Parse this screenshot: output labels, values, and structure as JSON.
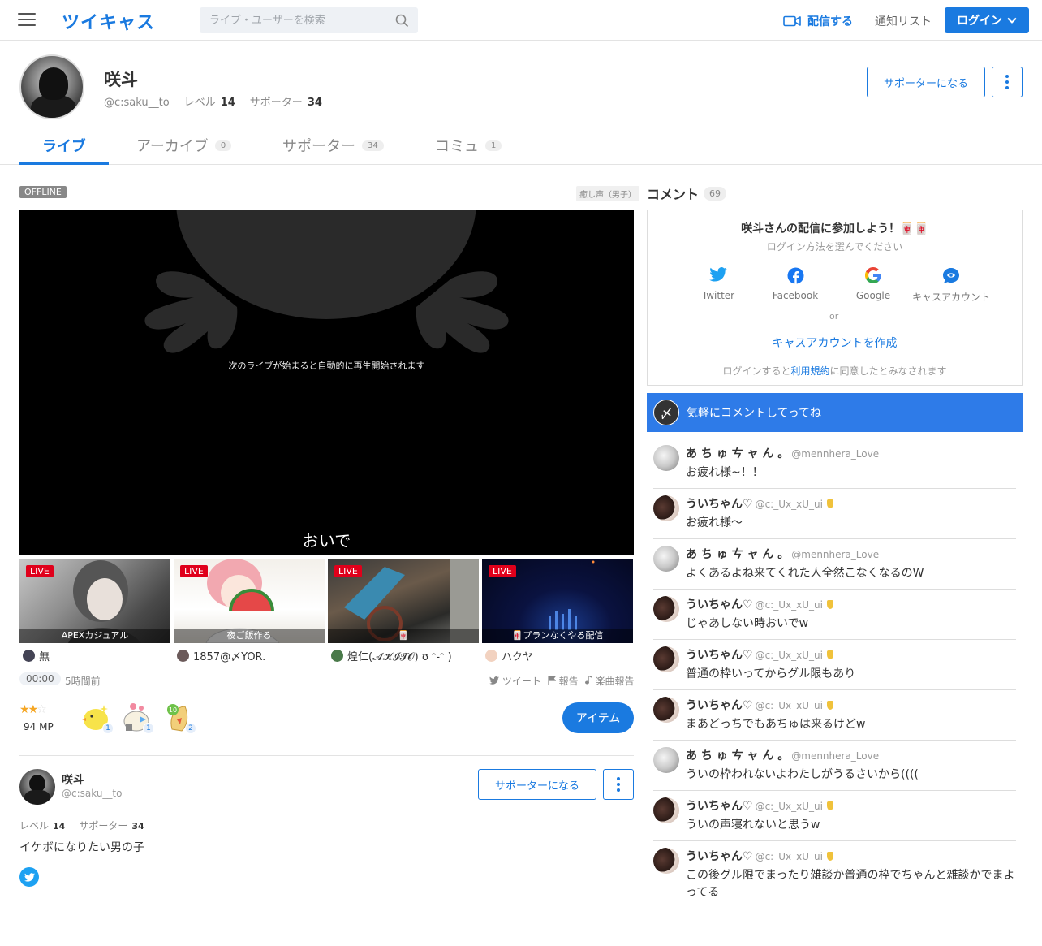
{
  "header": {
    "logo": "ツイキャス",
    "search_placeholder": "ライブ・ユーザーを検索",
    "broadcast_label": "配信する",
    "notification_label": "通知リスト",
    "login_label": "ログイン"
  },
  "profile": {
    "name": "咲斗",
    "id": "@c:saku__to",
    "level_label": "レベル",
    "level": "14",
    "supporter_label": "サポーター",
    "supporter_count": "34",
    "become_supporter": "サポーターになる"
  },
  "tabs": [
    {
      "label": "ライブ",
      "count": ""
    },
    {
      "label": "アーカイブ",
      "count": "0"
    },
    {
      "label": "サポーター",
      "count": "34"
    },
    {
      "label": "コミュ",
      "count": "1"
    }
  ],
  "live": {
    "status": "OFFLINE",
    "tag": "癒し声（男子）",
    "player_message": "次のライブが始まると自動的に再生開始されます",
    "player_title": "おいで",
    "time": "00:00",
    "ago": "5時間前",
    "tweet": "ツイート",
    "report": "報告",
    "music_report": "楽曲報告",
    "mp": "94 MP",
    "item_button": "アイテム",
    "gifts": [
      {
        "count": "1"
      },
      {
        "count": "1"
      },
      {
        "count": "2"
      }
    ]
  },
  "thumbs": [
    {
      "live": "LIVE",
      "caption": "APEXカジュアル",
      "user": "無"
    },
    {
      "live": "LIVE",
      "caption": "夜ご飯作る",
      "user": "1857@〆YOR."
    },
    {
      "live": "LIVE",
      "caption": "🀄",
      "user": "煌仁(𝓐𝓚𝓘𝓣𝓞) ʊ ᵔ-ᵔ )"
    },
    {
      "live": "LIVE",
      "caption": "🀄プランなくやる配信",
      "user": "ハクヤ"
    }
  ],
  "about": {
    "name": "咲斗",
    "id": "@c:saku__to",
    "level_label": "レベル",
    "level": "14",
    "supporter_label": "サポーター",
    "supporter_count": "34",
    "bio": "イケボになりたい男の子",
    "become_supporter": "サポーターになる"
  },
  "comments_panel": {
    "title": "コメント",
    "count": "69",
    "login_title": "咲斗さんの配信に参加しよう！🀄🀄",
    "login_sub": "ログイン方法を選んでください",
    "options": [
      "Twitter",
      "Facebook",
      "Google",
      "キャスアカウント"
    ],
    "or": "or",
    "create_account": "キャスアカウントを作成",
    "terms_pre": "ログインすると",
    "terms_link": "利用規約",
    "terms_post": "に同意したとみなされます",
    "input_placeholder": "気軽にコメントしてってね"
  },
  "comments": [
    {
      "name": "あ ち ゅ ㄘ ャ ん 。",
      "id": "@mennhera_Love",
      "text": "お疲れ様~！！",
      "medal": false,
      "av": "a"
    },
    {
      "name": "ういちゃん♡",
      "id": "@c:_Ux_xU_ui",
      "text": "お疲れ様〜",
      "medal": true,
      "av": "b"
    },
    {
      "name": "あ ち ゅ ㄘ ャ ん 。",
      "id": "@mennhera_Love",
      "text": "よくあるよね来てくれた人全然こなくなるのW",
      "medal": false,
      "av": "a"
    },
    {
      "name": "ういちゃん♡",
      "id": "@c:_Ux_xU_ui",
      "text": "じゃあしない時おいでw",
      "medal": true,
      "av": "b"
    },
    {
      "name": "ういちゃん♡",
      "id": "@c:_Ux_xU_ui",
      "text": "普通の枠いってからグル限もあり",
      "medal": true,
      "av": "b"
    },
    {
      "name": "ういちゃん♡",
      "id": "@c:_Ux_xU_ui",
      "text": "まあどっちでもあちゅは来るけどw",
      "medal": true,
      "av": "b"
    },
    {
      "name": "あ ち ゅ ㄘ ャ ん 。",
      "id": "@mennhera_Love",
      "text": "ういの枠われないよわたしがうるさいから((((",
      "medal": false,
      "av": "a"
    },
    {
      "name": "ういちゃん♡",
      "id": "@c:_Ux_xU_ui",
      "text": "ういの声寝れないと思うw",
      "medal": true,
      "av": "b"
    },
    {
      "name": "ういちゃん♡",
      "id": "@c:_Ux_xU_ui",
      "text": "この後グル限でまったり雑談か普通の枠でちゃんと雑談かでまよってる",
      "medal": true,
      "av": "b"
    }
  ]
}
